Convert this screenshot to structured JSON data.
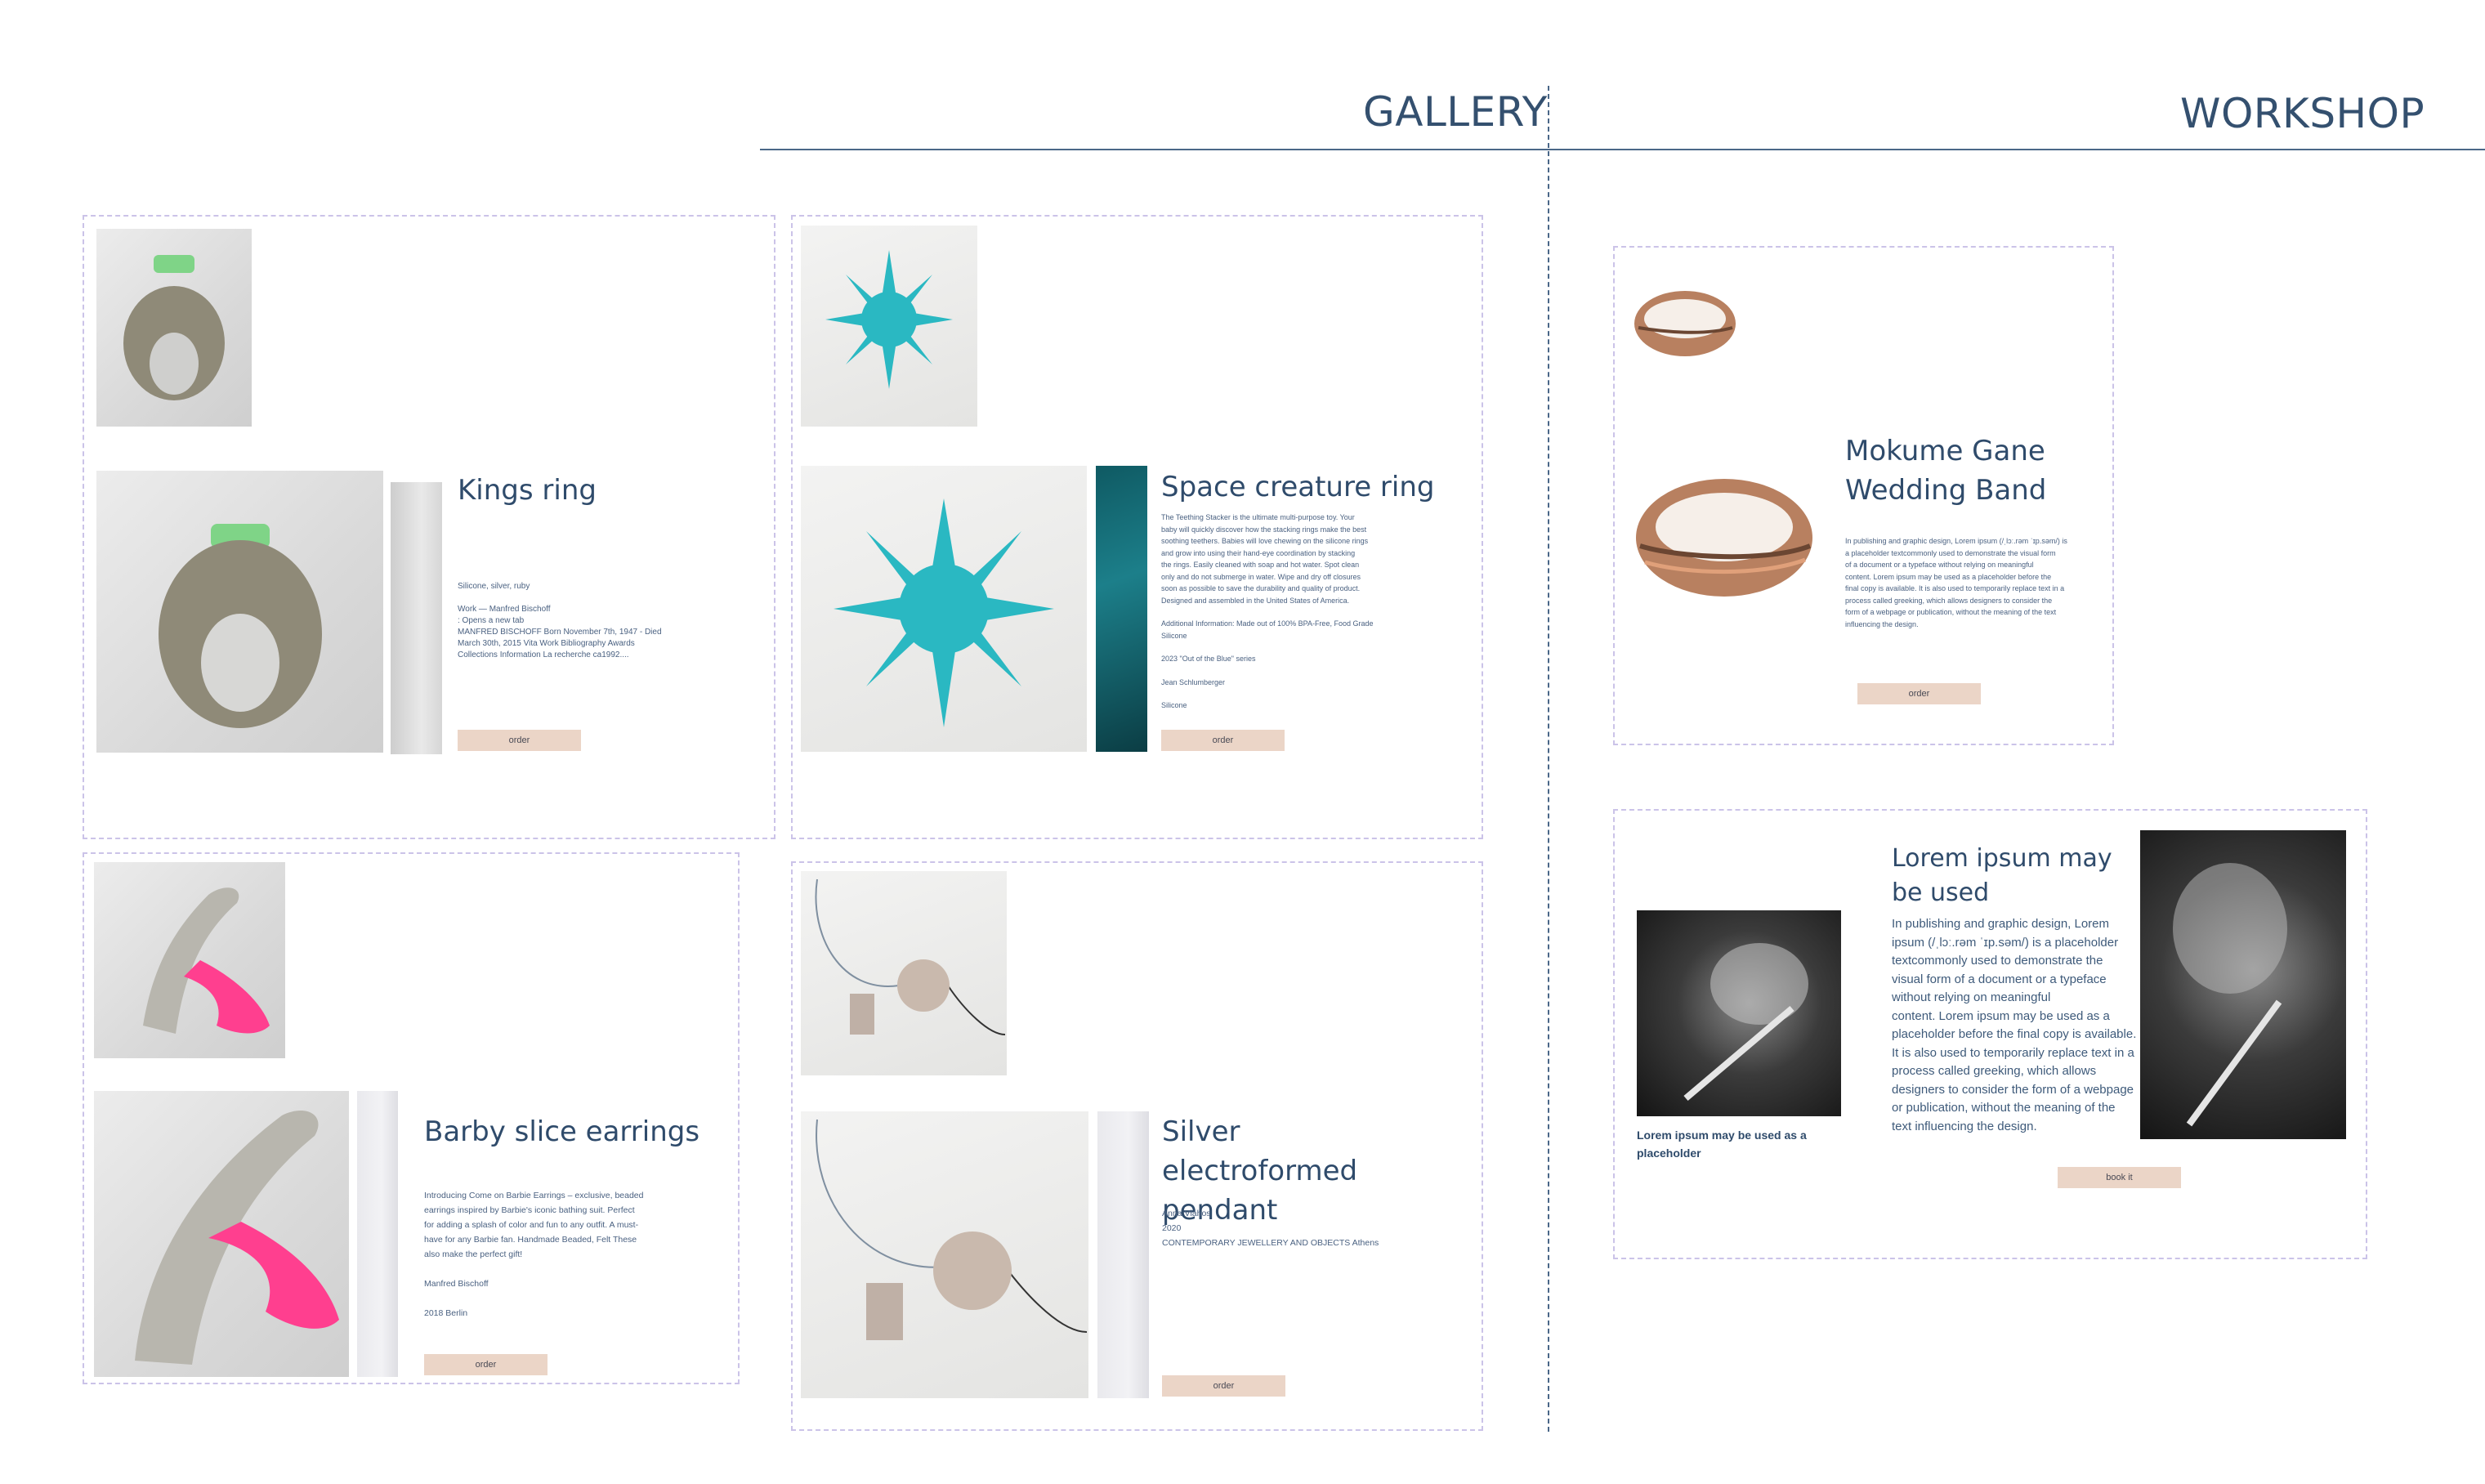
{
  "nav": {
    "gallery": "GALLERY",
    "workshop": "WORKSHOP"
  },
  "gallery": {
    "items": [
      {
        "title": "Kings ring",
        "details": [
          "Silicone, silver, ruby",
          "",
          "Work — Manfred Bischoff",
          ": Opens a new tab",
          "MANFRED BISCHOFF Born November 7th, 1947 - Died",
          "March 30th, 2015 Vita Work Bibliography Awards",
          "Collections Information La recherche ca1992...."
        ],
        "button": "order"
      },
      {
        "title": "Space creature ring",
        "details": [
          "The Teething Stacker is the ultimate multi-purpose toy. Your",
          "baby will quickly discover how the stacking rings make the best",
          "soothing teethers. Babies will love chewing on the silicone rings",
          "and grow into using their hand-eye coordination by stacking",
          "the rings. Easily cleaned with soap and hot water. Spot clean",
          "only and do not submerge in water. Wipe and dry off closures",
          "soon as possible to save the durability and quality of product.",
          "Designed and assembled in the United States of America.",
          "",
          "Additional Information: Made out of 100% BPA-Free, Food Grade",
          "Silicone",
          "",
          "2023 \"Out of the Blue\" series",
          "",
          "Jean Schlumberger",
          "",
          "Silicone"
        ],
        "button": "order"
      },
      {
        "title": "Barby slice earrings",
        "details": [
          "Introducing Come on Barbie Earrings – exclusive, beaded",
          "earrings inspired by Barbie's iconic bathing suit. Perfect",
          "for adding a splash of color and fun to any outfit. A must-",
          "have for any Barbie fan. Handmade Beaded, Felt These",
          "also make the perfect gift!",
          "",
          "Manfred Bischoff",
          "",
          "2018 Berlin"
        ],
        "button": "order"
      },
      {
        "title": "Silver electroformed pendant",
        "details": [
          "Anna Vlahos",
          "2020",
          "CONTEMPORARY JEWELLERY AND OBJECTS Athens"
        ],
        "button": "order"
      }
    ]
  },
  "workshop": {
    "mokume": {
      "title": "Mokume Gane Wedding Band",
      "details": [
        "In publishing and graphic design, Lorem ipsum (/ˌlɔː.rəm ˈɪp.səm/) is",
        "a placeholder textcommonly used to demonstrate the visual form",
        "of a document or a typeface without relying on meaningful",
        "content. Lorem ipsum may be used as a placeholder before the",
        "final copy is available. It is also used to temporarily replace text in a",
        "process called greeking, which allows designers to consider the",
        "form of a webpage or publication, without the meaning of the text",
        "influencing the design."
      ],
      "button": "order"
    },
    "course": {
      "title": "Lorem ipsum may be used",
      "caption": "Lorem ipsum may be used as a placeholder",
      "paragraph": [
        "In publishing and graphic design, Lorem",
        "ipsum (/ˌlɔː.rəm ˈɪp.səm/) is a placeholder",
        "textcommonly used to demonstrate the",
        "visual form of a document or a typeface",
        "without relying on meaningful",
        "content. Lorem ipsum may be used as a",
        "placeholder before the final copy is available.",
        "It is also used to temporarily replace text in a",
        "process called greeking, which allows",
        "designers to consider the form of a webpage",
        "or publication, without the meaning of the",
        "text influencing the design."
      ],
      "button": "book it"
    }
  },
  "colors": {
    "accent_button": "#ebd5c7",
    "text": "#2f4b6b",
    "card_border": "#cbc3e8"
  }
}
